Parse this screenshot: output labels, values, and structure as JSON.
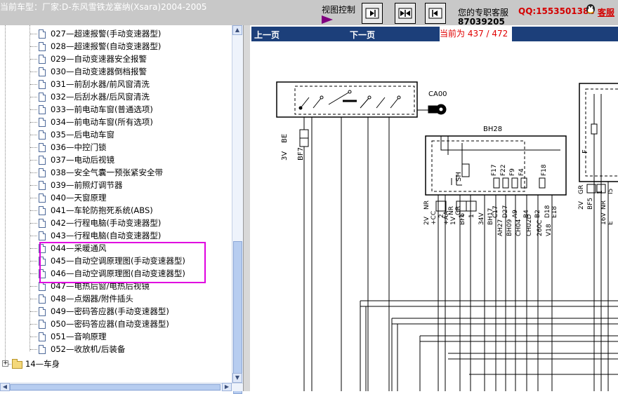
{
  "header": {
    "car_model": "当前车型：厂家:D-东风雪铁龙塞纳(Xsara)2004-2005",
    "view_control_label": "视图控制",
    "service_label": "您的专职客服",
    "service_phone": "87039205",
    "qq": "QQ:1553501388",
    "kefu": "客服"
  },
  "tree": {
    "items": [
      {
        "label": "027—超速报警(手动变速器型)"
      },
      {
        "label": "028—超速报警(自动变速器型)"
      },
      {
        "label": "029—自动变速器安全报警"
      },
      {
        "label": "030—自动变速器倒档报警"
      },
      {
        "label": "031—前刮水器/前风窗清洗"
      },
      {
        "label": "032—后刮水器/后风窗清洗"
      },
      {
        "label": "033—前电动车窗(普通选项)"
      },
      {
        "label": "034—前电动车窗(所有选项)"
      },
      {
        "label": "035—后电动车窗"
      },
      {
        "label": "036—中控门锁"
      },
      {
        "label": "037—电动后视镜"
      },
      {
        "label": "038—安全气囊一预张紧安全带"
      },
      {
        "label": "039—前照灯调节器"
      },
      {
        "label": "040—天窗原理"
      },
      {
        "label": "041—车轮防抱死系统(ABS)"
      },
      {
        "label": "042—行程电脑(手动变速器型)"
      },
      {
        "label": "043—行程电脑(自动变速器型)"
      },
      {
        "label": "044—采暖通风",
        "selected": true
      },
      {
        "label": "045—自动空调原理图(手动变速器型)"
      },
      {
        "label": "046—自动空调原理图(自动变速器型)"
      },
      {
        "label": "047—电热后窗/电热后视镜"
      },
      {
        "label": "048—点烟器/附件插头"
      },
      {
        "label": "049—密码答应器(手动变速器型)"
      },
      {
        "label": "050—密码答应器(自动变速器型)"
      },
      {
        "label": "051—音响原理"
      },
      {
        "label": "052—收放机/后装备"
      }
    ],
    "folder": {
      "label": "14—车身",
      "expander": "+"
    }
  },
  "viewer": {
    "prev_label": "上一页",
    "next_label": "下一页",
    "current_page": "当前为  437 / 472"
  },
  "diagram": {
    "labels": {
      "ca00": "CA00",
      "bh28": "BH28",
      "left_conn": [
        "3V",
        "BE",
        "BF7"
      ],
      "sh": "SH",
      "fuses": [
        "F17",
        "F22",
        "F9",
        "F4",
        "F18"
      ],
      "f": "F",
      "row1": [
        "2",
        "1",
        "1",
        "C17",
        "D27",
        "A9",
        "B4",
        "B2",
        "D18",
        "E18"
      ],
      "row1_sub": [
        "+CC",
        "+AA",
        "GR",
        "NR"
      ],
      "row2": [
        "2V",
        "NR",
        "1V",
        "BF6",
        "34V",
        "BH17",
        "AH27",
        "BH09",
        "CH04",
        "CH02D",
        "260C",
        "V18"
      ],
      "right_conn": [
        "2V",
        "GR",
        "BF5",
        "1",
        "16V",
        "NR",
        "E",
        "I5"
      ]
    }
  },
  "colors": {
    "navbar": "#1c3f7a",
    "highlight": "#e000e0",
    "page_indicator": "#e00000",
    "qq": "#d40000"
  }
}
